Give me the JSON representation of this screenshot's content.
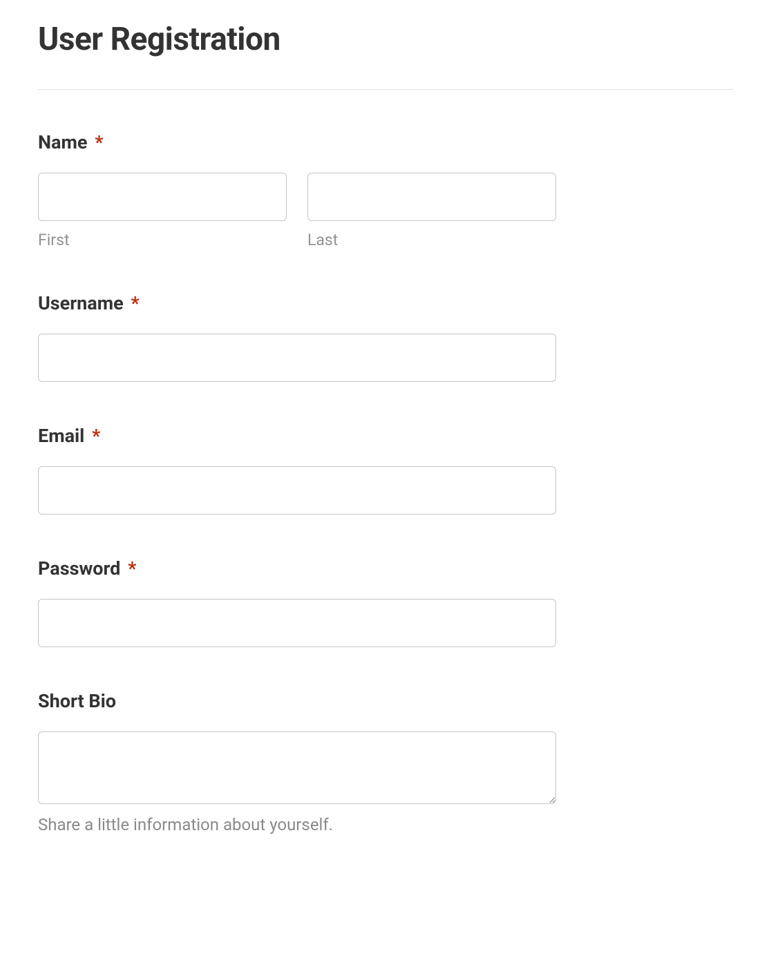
{
  "page": {
    "title": "User Registration"
  },
  "fields": {
    "name": {
      "label": "Name",
      "required": true,
      "first_sub": "First",
      "last_sub": "Last",
      "first_value": "",
      "last_value": ""
    },
    "username": {
      "label": "Username",
      "required": true,
      "value": ""
    },
    "email": {
      "label": "Email",
      "required": true,
      "value": ""
    },
    "password": {
      "label": "Password",
      "required": true,
      "value": ""
    },
    "bio": {
      "label": "Short Bio",
      "required": false,
      "value": "",
      "help": "Share a little information about yourself."
    }
  },
  "required_mark": "*"
}
